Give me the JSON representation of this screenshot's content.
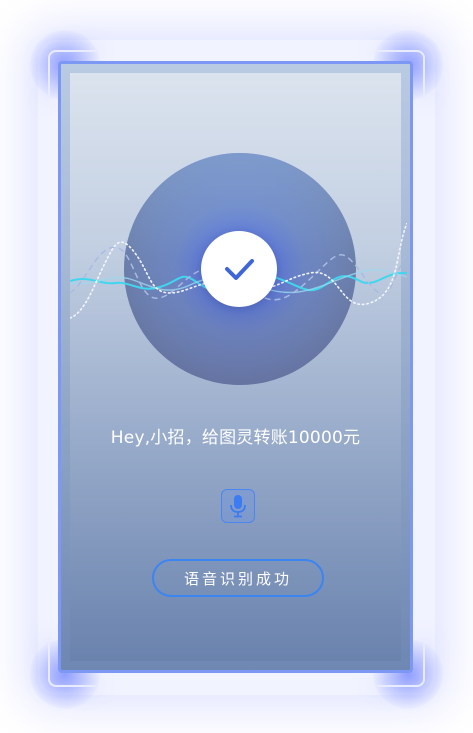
{
  "recognized_text": "Hey,小招，给图灵转账10000元",
  "status_label": "语音识别成功",
  "icons": {
    "center": "checkmark-icon",
    "mic": "microphone-icon"
  },
  "colors": {
    "accent": "#3b84f4",
    "frame": "#7d97f5",
    "check": "#3f66d8",
    "wave_cyan": "#3fd7ee"
  }
}
